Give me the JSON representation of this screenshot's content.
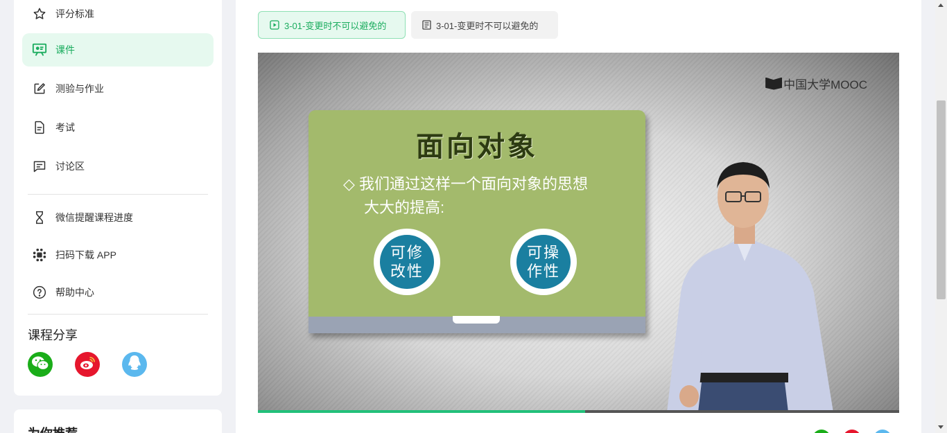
{
  "sidebar": {
    "items": [
      {
        "label": "评分标准",
        "icon": "star-icon"
      },
      {
        "label": "课件",
        "icon": "presentation-icon",
        "active": true
      },
      {
        "label": "测验与作业",
        "icon": "edit-icon"
      },
      {
        "label": "考试",
        "icon": "document-icon"
      },
      {
        "label": "讨论区",
        "icon": "chat-icon"
      },
      {
        "label": "微信提醒课程进度",
        "icon": "hourglass-icon"
      },
      {
        "label": "扫码下载 APP",
        "icon": "app-icon"
      },
      {
        "label": "帮助中心",
        "icon": "help-icon"
      }
    ],
    "share_title": "课程分享",
    "share": [
      {
        "name": "wechat-icon",
        "color": "#1aad19"
      },
      {
        "name": "weibo-icon",
        "color": "#e6162d"
      },
      {
        "name": "qq-icon",
        "color": "#5bb8ee"
      }
    ],
    "recommend_title": "为你推荐"
  },
  "tabs": {
    "video_label": "3-01-变更时不可以避免的",
    "doc_label": "3-01-变更时不可以避免的"
  },
  "video": {
    "logo_text": "中国大学MOOC",
    "board_title": "面向对象",
    "bullet_line1": "我们通过这样一个面向对象的思想",
    "bullet_line2": "大大的提高:",
    "bubble1": "可修改性",
    "bubble2": "可操作性",
    "progress": 0.51
  },
  "colors": {
    "accent": "#1aac5e",
    "accent_bg": "#e6f9ef",
    "board": "#a3ba6c"
  }
}
